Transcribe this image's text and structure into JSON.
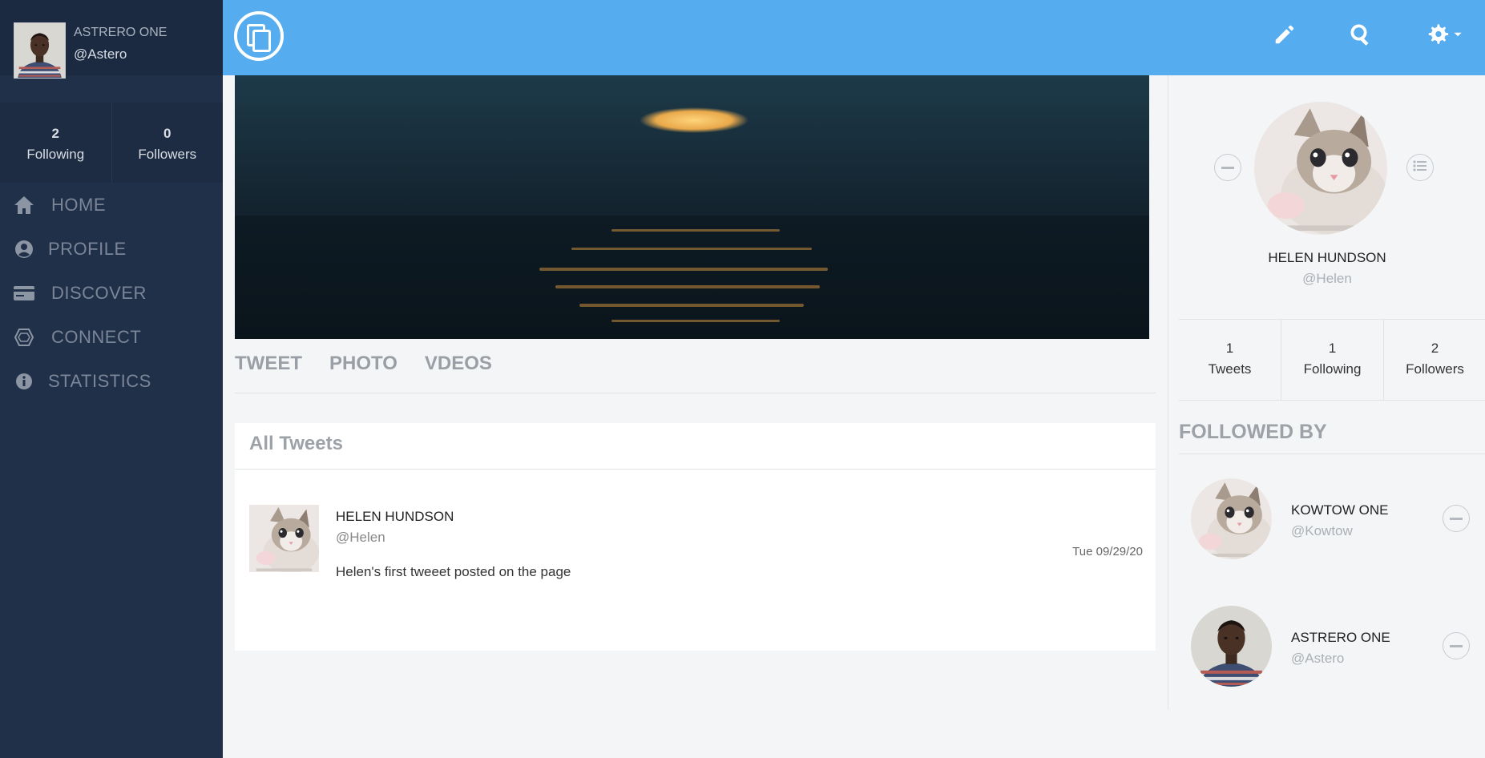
{
  "sidebar": {
    "user": {
      "name": "ASTRERO ONE",
      "handle": "@Astero"
    },
    "stats": [
      {
        "value": "2",
        "label": "Following"
      },
      {
        "value": "0",
        "label": "Followers"
      }
    ],
    "nav": [
      {
        "label": "HOME",
        "icon": "home-icon"
      },
      {
        "label": "PROFILE",
        "icon": "user-circle-icon"
      },
      {
        "label": "DISCOVER",
        "icon": "card-icon"
      },
      {
        "label": "CONNECT",
        "icon": "hexagon-icon"
      },
      {
        "label": "STATISTICS",
        "icon": "info-icon"
      }
    ]
  },
  "topbar": {
    "logo": "copy-logo-icon",
    "icons": [
      "pencil-icon",
      "search-icon",
      "gear-icon"
    ]
  },
  "tabs": [
    "TWEET",
    "PHOTO",
    "VDEOS"
  ],
  "tweets": {
    "title": "All Tweets",
    "items": [
      {
        "name": "HELEN HUNDSON",
        "handle": "@Helen",
        "text": "Helen's first tweeet posted on the page",
        "date": "Tue 09/29/20"
      }
    ]
  },
  "profile": {
    "name": "HELEN HUNDSON",
    "handle": "@Helen",
    "stats": [
      {
        "value": "1",
        "label": "Tweets"
      },
      {
        "value": "1",
        "label": "Following"
      },
      {
        "value": "2",
        "label": "Followers"
      }
    ]
  },
  "followed_by": {
    "title": "FOLLOWED BY",
    "items": [
      {
        "name": "KOWTOW ONE",
        "handle": "@Kowtow"
      },
      {
        "name": "ASTRERO ONE",
        "handle": "@Astero"
      }
    ]
  },
  "colors": {
    "topbar": "#55acee",
    "sidebar": "#203049",
    "background": "#f4f5f7"
  }
}
